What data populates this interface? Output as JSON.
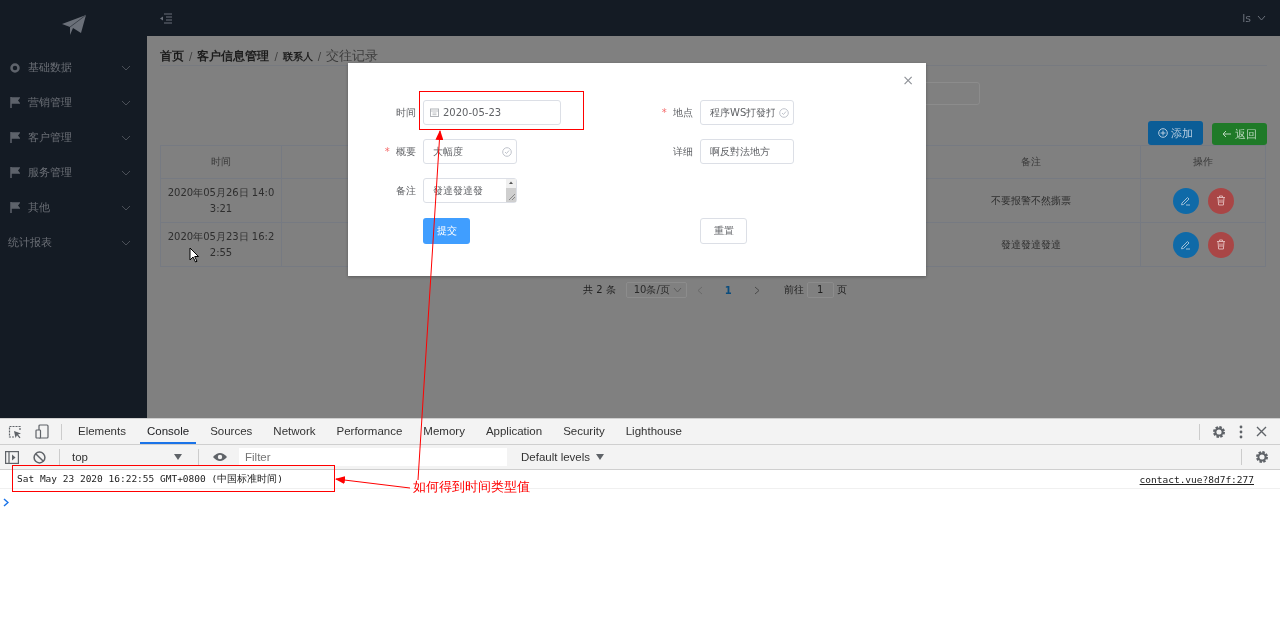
{
  "sidebar": {
    "items": [
      {
        "label": "基础数据",
        "kind": "ring"
      },
      {
        "label": "营销管理",
        "kind": "flag"
      },
      {
        "label": "客户管理",
        "kind": "flag"
      },
      {
        "label": "服务管理",
        "kind": "flag"
      },
      {
        "label": "其他",
        "kind": "flag"
      },
      {
        "label": "统计报表",
        "kind": "plain"
      }
    ]
  },
  "header": {
    "user": "ls"
  },
  "breadcrumb_separator": "/",
  "breadcrumb": [
    {
      "label": "首页",
      "current": false
    },
    {
      "label": "客户信息管理",
      "current": false
    },
    {
      "label": "联系人",
      "current": false
    },
    {
      "label": "交往记录",
      "current": true
    }
  ],
  "toolbar": [
    {
      "label": "添加",
      "kind": "add"
    },
    {
      "label": "返回",
      "kind": "back"
    }
  ],
  "table": {
    "columns": [
      "时间",
      "备注",
      "操作"
    ],
    "rows": [
      {
        "time": "2020年05月26日 14:03:21",
        "note": "不要报警不然撕票"
      },
      {
        "time": "2020年05月23日 16:22:55",
        "note": "發達發達發達"
      }
    ]
  },
  "pagination": {
    "total": "共 2 条",
    "page_size": "10条/页",
    "pages": [
      {
        "label": "1",
        "selected": true
      }
    ],
    "goto_label": "前往",
    "goto_value": "1",
    "goto_suffix": "页"
  },
  "dialog": {
    "close": "×",
    "required_mark": "*",
    "left_fields": [
      {
        "label": "时间",
        "required": false,
        "value": "2020-05-23",
        "kind": "date",
        "validated": false
      },
      {
        "label": "概要",
        "required": true,
        "value": "大幅度",
        "kind": "text",
        "validated": true
      },
      {
        "label": "备注",
        "required": false,
        "value": "發達發達發",
        "kind": "textarea",
        "validated": false
      }
    ],
    "right_fields": [
      {
        "label": "地点",
        "required": true,
        "value": "程序WS打發打",
        "kind": "text",
        "validated": true
      },
      {
        "label": "详细",
        "required": false,
        "value": "啊反對法地方",
        "kind": "text",
        "validated": false
      }
    ],
    "submit": "提交",
    "reset": "重置"
  },
  "devtools": {
    "tabs": [
      {
        "label": "Elements",
        "selected": false
      },
      {
        "label": "Console",
        "selected": true
      },
      {
        "label": "Sources",
        "selected": false
      },
      {
        "label": "Network",
        "selected": false
      },
      {
        "label": "Performance",
        "selected": false
      },
      {
        "label": "Memory",
        "selected": false
      },
      {
        "label": "Application",
        "selected": false
      },
      {
        "label": "Security",
        "selected": false
      },
      {
        "label": "Lighthouse",
        "selected": false
      }
    ],
    "context": "top",
    "filter_placeholder": "Filter",
    "levels": "Default levels",
    "log": {
      "text": "Sat May 23 2020 16:22:55 GMT+0800 (中国标准时间)",
      "source": "contact.vue?8d7f:277"
    }
  },
  "annotation": {
    "text": "如何得到时间类型值"
  }
}
